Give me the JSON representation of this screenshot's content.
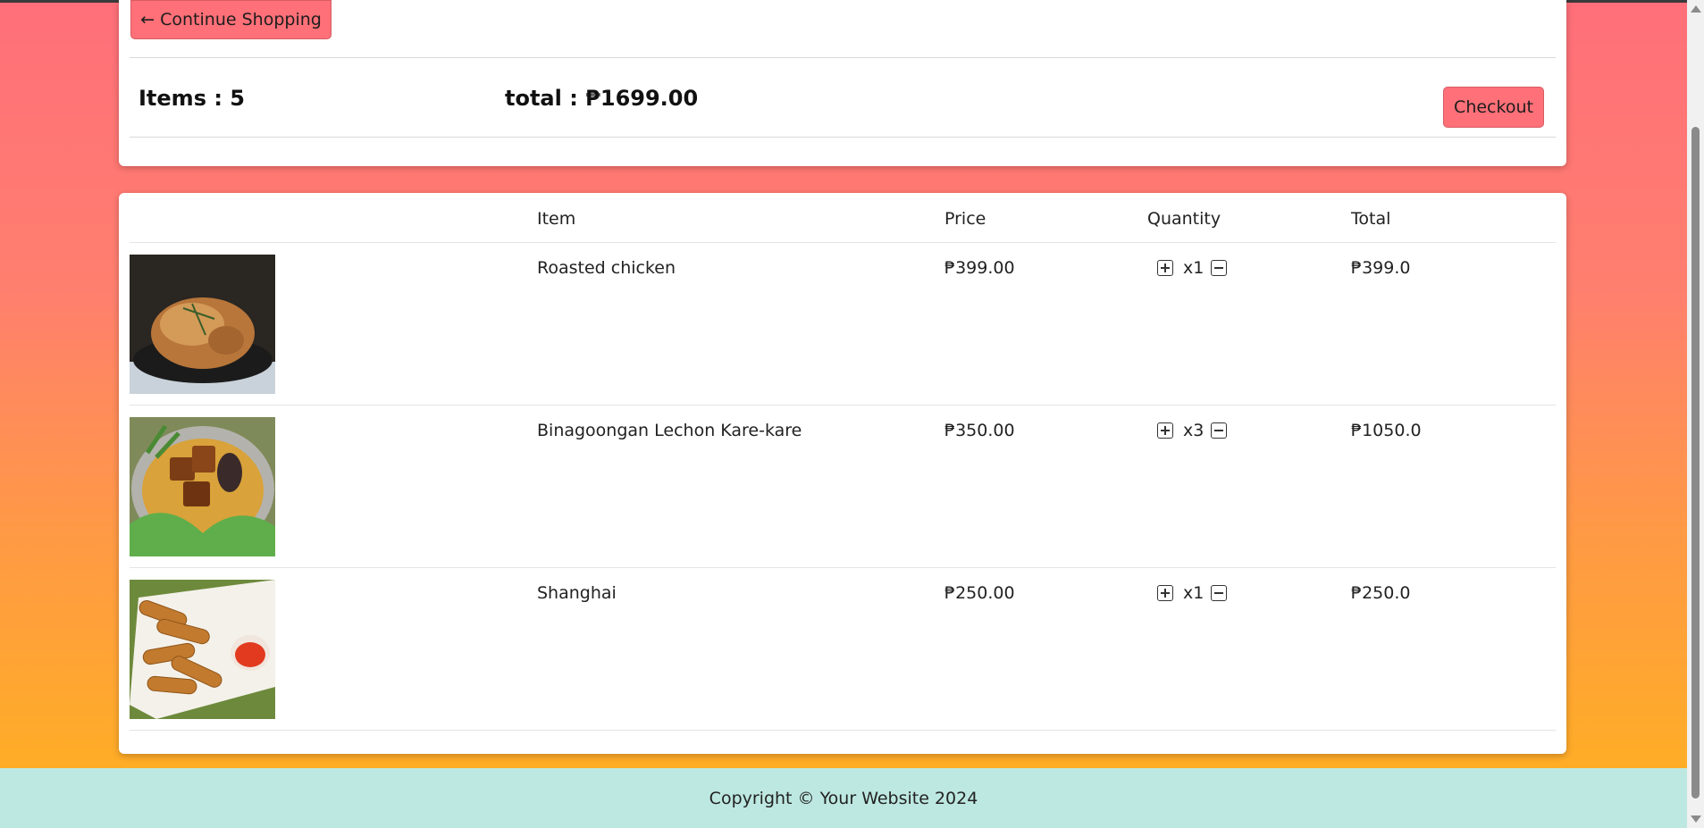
{
  "summary": {
    "continue_label": "← Continue Shopping",
    "items_text": "Items : 5",
    "total_text": "total : ₱1699.00",
    "checkout_label": "Checkout"
  },
  "table": {
    "headers": {
      "image": "",
      "item": "Item",
      "price": "Price",
      "quantity": "Quantity",
      "total": "Total"
    },
    "rows": [
      {
        "name": "Roasted chicken",
        "price": "₱399.00",
        "qty": "x1",
        "total": "₱399.0",
        "image": "roasted-chicken-photo"
      },
      {
        "name": "Binagoongan Lechon Kare-kare",
        "price": "₱350.00",
        "qty": "x3",
        "total": "₱1050.0",
        "image": "kare-kare-photo"
      },
      {
        "name": "Shanghai",
        "price": "₱250.00",
        "qty": "x1",
        "total": "₱250.0",
        "image": "lumpia-shanghai-photo"
      }
    ]
  },
  "footer": {
    "copyright": "Copyright © Your Website 2024"
  },
  "colors": {
    "accent_button": "#ff7078",
    "footer_bg": "#bde8e1",
    "gradient_top": "#ff6f7a",
    "gradient_bottom": "#ffb21f"
  }
}
